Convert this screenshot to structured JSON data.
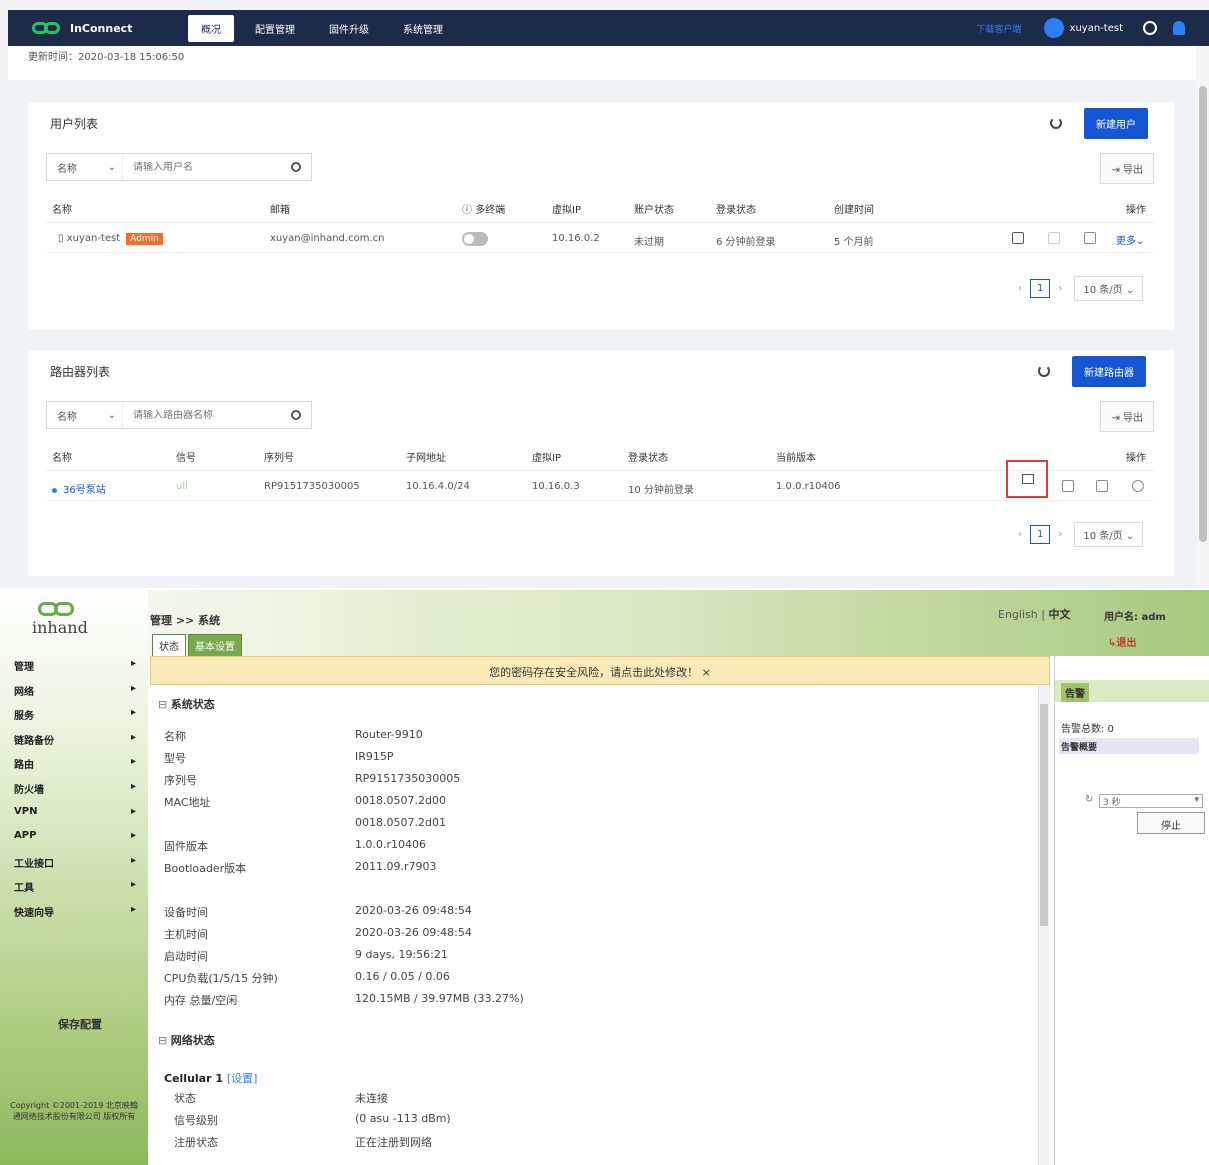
{
  "inconnect": {
    "brand": "InConnect",
    "nav": [
      "概况",
      "配置管理",
      "固件升级",
      "系统管理"
    ],
    "header_link": "下载客户端",
    "user": "xuyan-test",
    "update_time": "更新时间：2020-03-18 15:06:50",
    "users_panel": {
      "title": "用户列表",
      "new_button": "新建用户",
      "search_select": "名称",
      "search_placeholder": "请输入用户名",
      "export_button": "导出",
      "columns": [
        "名称",
        "邮箱",
        "多终端",
        "虚拟IP",
        "账户状态",
        "登录状态",
        "创建时间",
        "操作"
      ],
      "row": {
        "name": "xuyan-test",
        "badge": "Admin",
        "email": "xuyan@inhand.com.cn",
        "virtual_ip": "10.16.0.2",
        "account_status": "未过期",
        "login_status": "6 分钟前登录",
        "created": "5 个月前",
        "more": "更多"
      },
      "page": "1",
      "page_size": "10 条/页"
    },
    "routers_panel": {
      "title": "路由器列表",
      "new_button": "新建路由器",
      "search_select": "名称",
      "search_placeholder": "请输入路由器名称",
      "export_button": "导出",
      "columns": [
        "名称",
        "信号",
        "序列号",
        "子网地址",
        "虚拟IP",
        "登录状态",
        "当前版本",
        "操作"
      ],
      "row": {
        "name": "36号泵站",
        "signal": "ull",
        "serial": "RP9151735030005",
        "subnet": "10.16.4.0/24",
        "virtual_ip": "10.16.0.3",
        "login_status": "10 分钟前登录",
        "version": "1.0.0.r10406"
      },
      "page": "1",
      "page_size": "10 条/页"
    }
  },
  "router_web": {
    "logo_text": "inhand",
    "breadcrumb": "管理 >> 系统",
    "tabs": [
      "状态",
      "基本设置"
    ],
    "lang_en": "English",
    "lang_sep": "|",
    "lang_zh": "中文",
    "user_label": "用户名: adm",
    "logout": "退出",
    "warning": "您的密码存在安全风险，请点击此处修改！  ×",
    "menu": [
      "管理",
      "网络",
      "服务",
      "链路备份",
      "路由",
      "防火墙",
      "VPN",
      "APP",
      "工业接口",
      "工具",
      "快速向导"
    ],
    "menu_arrow": "▸",
    "save_config": "保存配置",
    "copyright": "Copyright ©2001-2019 北京映翰通网络技术股份有限公司 版权所有",
    "system_status": {
      "title": "系统状态",
      "rows": [
        {
          "k": "名称",
          "v": "Router-9910"
        },
        {
          "k": "型号",
          "v": "IR915P"
        },
        {
          "k": "序列号",
          "v": "RP9151735030005"
        },
        {
          "k": "MAC地址",
          "v": "0018.0507.2d00"
        },
        {
          "k": "",
          "v": "0018.0507.2d01"
        },
        {
          "k": "固件版本",
          "v": "1.0.0.r10406"
        },
        {
          "k": "Bootloader版本",
          "v": "2011.09.r7903"
        },
        {
          "k": "设备时间",
          "v": "2020-03-26 09:48:54"
        },
        {
          "k": "主机时间",
          "v": "2020-03-26 09:48:54"
        },
        {
          "k": "启动时间",
          "v": "9 days, 19:56:21"
        },
        {
          "k": "CPU负载(1/5/15 分钟)",
          "v": "0.16 / 0.05 / 0.06"
        },
        {
          "k": "内存 总量/空闲",
          "v": "120.15MB / 39.97MB (33.27%)"
        }
      ]
    },
    "network_status": {
      "title": "网络状态",
      "cellular_title": "Cellular 1",
      "cellular_link": "[设置]",
      "rows": [
        {
          "k": "状态",
          "v": "未连接"
        },
        {
          "k": "信号级别",
          "v": "(0 asu -113 dBm)"
        },
        {
          "k": "注册状态",
          "v": "正在注册到网络"
        }
      ]
    },
    "alarm": {
      "tab": "告警",
      "count": "告警总数: 0",
      "summary": "告警概要",
      "refresh_value": "3 秒",
      "stop_button": "停止"
    }
  }
}
